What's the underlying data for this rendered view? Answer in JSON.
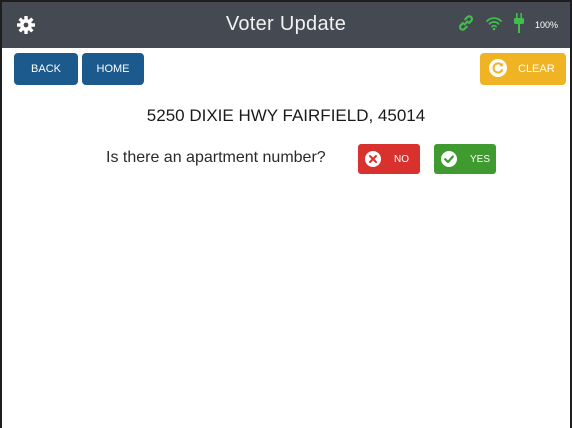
{
  "window": {
    "title": "Voter Update"
  },
  "status_bar": {
    "battery_percent": "100%",
    "icons": [
      "link-icon",
      "wifi-icon",
      "power-plug-icon"
    ]
  },
  "toolbar": {
    "back_label": "BACK",
    "home_label": "HOME",
    "clear_label": "CLEAR"
  },
  "main": {
    "address": "5250 DIXIE HWY FAIRFIELD, 45014",
    "question": "Is there an apartment number?",
    "no_label": "NO",
    "yes_label": "YES"
  },
  "colors": {
    "titlebar": "#454952",
    "primary_button": "#1c5a8e",
    "clear_button": "#f0b323",
    "no_button": "#d9322e",
    "yes_button": "#3f9b30",
    "status_icons": "#3fbf4a"
  }
}
